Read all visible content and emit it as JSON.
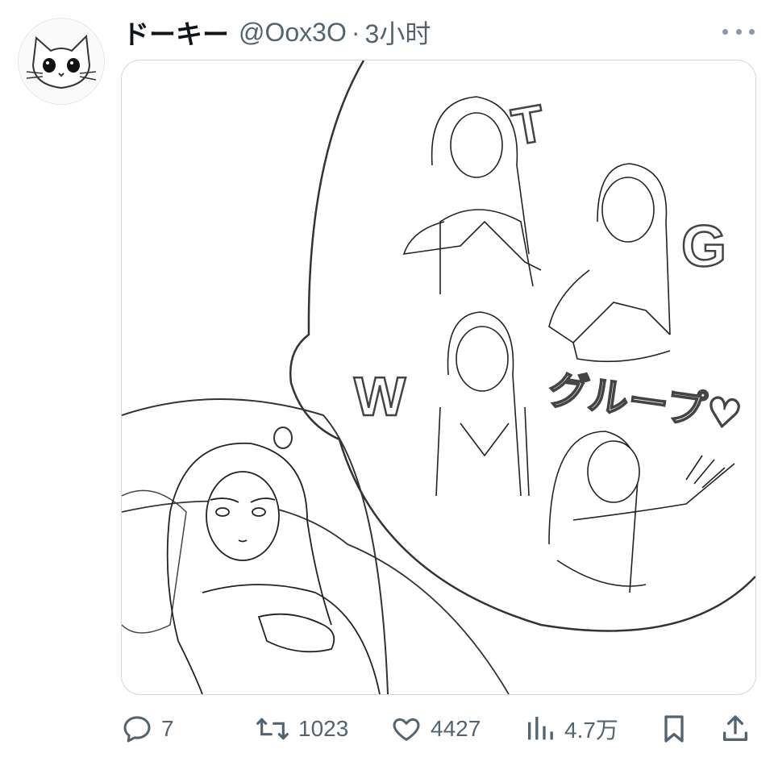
{
  "post": {
    "author_name": "ドーキー",
    "handle": "@Oox3O",
    "separator": "·",
    "time": "3小时"
  },
  "media": {
    "letters": [
      "T",
      "G",
      "W"
    ],
    "katakana": "グループ♡"
  },
  "actions": {
    "reply_count": "7",
    "retweet_count": "1023",
    "like_count": "4427",
    "views_count": "4.7万"
  },
  "icons": {
    "avatar": "cat-avatar-icon",
    "more": "more-horizontal-icon",
    "reply": "reply-icon",
    "retweet": "retweet-icon",
    "like": "heart-icon",
    "views": "views-bar-chart-icon",
    "bookmark": "bookmark-icon",
    "share": "share-icon"
  },
  "colors": {
    "text": "#0f1419",
    "muted": "#536471",
    "border": "#cfd9de"
  }
}
